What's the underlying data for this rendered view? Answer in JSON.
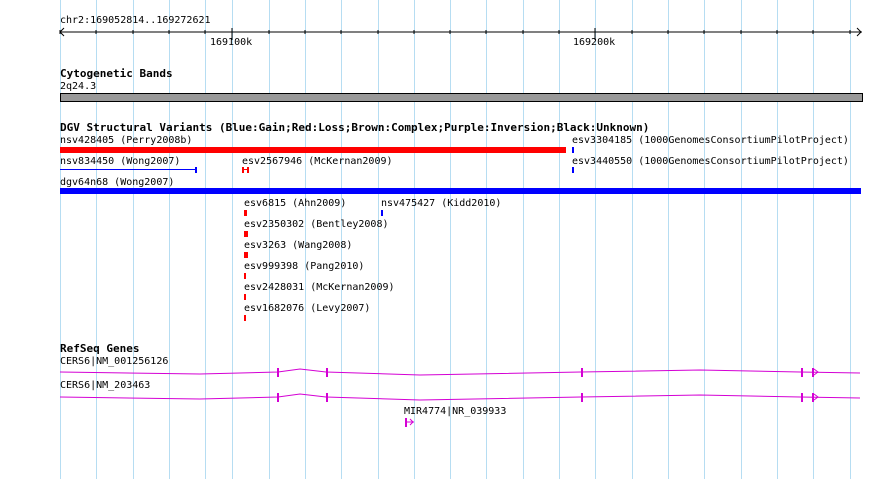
{
  "ruler": {
    "range_label": "chr2:169052814..169272621",
    "tick_labels": [
      "169100k",
      "169200k"
    ]
  },
  "cytoband": {
    "title": "Cytogenetic Bands",
    "band_label": "2q24.3"
  },
  "dgv": {
    "title": "DGV Structural Variants (Blue:Gain;Red:Loss;Brown:Complex;Purple:Inversion;Black:Unknown)",
    "colors": {
      "gain": "#0000ff",
      "loss": "#ff0000"
    },
    "features": [
      {
        "label": "nsv428405 (Perry2008b)"
      },
      {
        "label": "esv3304185 (1000GenomesConsortiumPilotProject)"
      },
      {
        "label": "nsv834450 (Wong2007)"
      },
      {
        "label": "esv2567946 (McKernan2009)"
      },
      {
        "label": "esv3440550 (1000GenomesConsortiumPilotProject)"
      },
      {
        "label": "dgv64n68 (Wong2007)"
      },
      {
        "label": "esv6815 (Ahn2009)"
      },
      {
        "label": "nsv475427 (Kidd2010)"
      },
      {
        "label": "esv2350302 (Bentley2008)"
      },
      {
        "label": "esv3263 (Wang2008)"
      },
      {
        "label": "esv999398 (Pang2010)"
      },
      {
        "label": "esv2428031 (McKernan2009)"
      },
      {
        "label": "esv1682076 (Levy2007)"
      }
    ]
  },
  "refseq": {
    "title": "RefSeq Genes",
    "color": "#d400d4",
    "genes": [
      {
        "label": "CERS6|NM_001256126"
      },
      {
        "label": "CERS6|NM_203463"
      },
      {
        "label": "MIR4774|NR_039933"
      }
    ]
  }
}
